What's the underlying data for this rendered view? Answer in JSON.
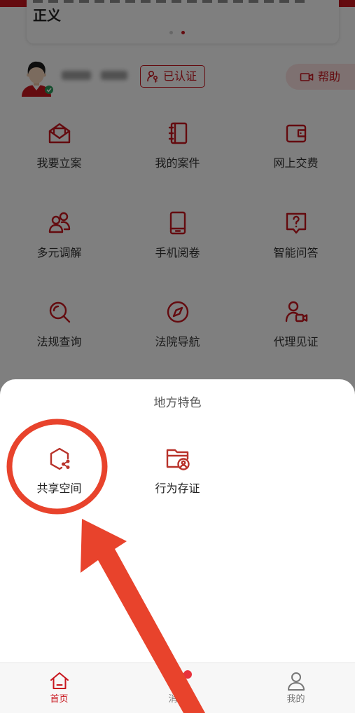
{
  "colors": {
    "brand_red": "#c8161e",
    "sheet_icon_red": "#b8322a",
    "annotation_red": "#e8432c",
    "tab_inactive": "#777777",
    "badge_dot": "#e8323c"
  },
  "top_card": {
    "headline_visible_text": "正义",
    "carousel": {
      "dots": 2,
      "active_dot": 2
    }
  },
  "user": {
    "avatar_icon": "cartoon-user-avatar",
    "verified_label": "已认证",
    "verified_icon": "person-key-icon",
    "help_label": "帮助",
    "help_icon": "video-camera-icon"
  },
  "services": [
    {
      "label": "我要立案",
      "icon": "envelope-house-icon"
    },
    {
      "label": "我的案件",
      "icon": "notebook-icon"
    },
    {
      "label": "网上交费",
      "icon": "wallet-icon"
    },
    {
      "label": "多元调解",
      "icon": "two-people-icon"
    },
    {
      "label": "手机阅卷",
      "icon": "tablet-icon"
    },
    {
      "label": "智能问答",
      "icon": "question-bubble-icon"
    },
    {
      "label": "法规查询",
      "icon": "magnifier-icon"
    },
    {
      "label": "法院导航",
      "icon": "compass-icon"
    },
    {
      "label": "代理见证",
      "icon": "person-camera-icon"
    }
  ],
  "sheet": {
    "title": "地方特色",
    "items": [
      {
        "label": "共享空间",
        "icon": "hexagon-share-icon"
      },
      {
        "label": "行为存证",
        "icon": "folder-user-icon"
      }
    ]
  },
  "tabbar": {
    "items": [
      {
        "label": "首页",
        "icon": "home-icon",
        "active": true,
        "badge": false
      },
      {
        "label": "消息",
        "icon": "message-icon",
        "active": false,
        "badge": true
      },
      {
        "label": "我的",
        "icon": "user-icon",
        "active": false,
        "badge": false
      }
    ]
  }
}
